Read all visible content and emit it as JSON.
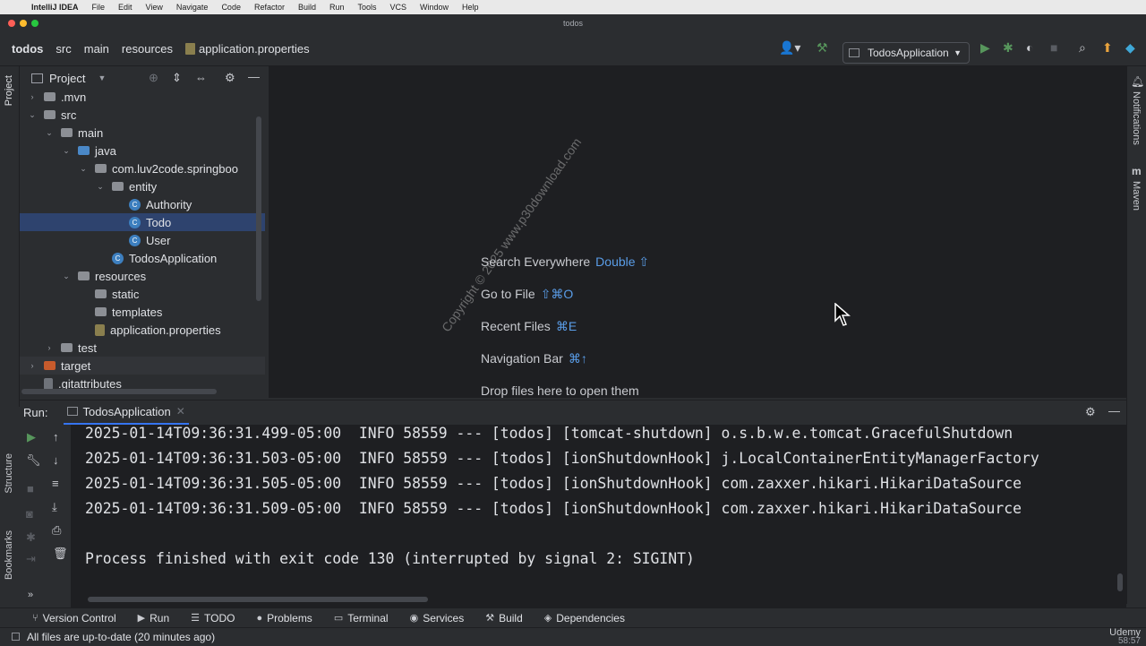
{
  "mac_menu": {
    "app": "IntelliJ IDEA",
    "items": [
      "File",
      "Edit",
      "View",
      "Navigate",
      "Code",
      "Refactor",
      "Build",
      "Run",
      "Tools",
      "VCS",
      "Window",
      "Help"
    ]
  },
  "window": {
    "title": "todos"
  },
  "breadcrumb": [
    "todos",
    "src",
    "main",
    "resources",
    "application.properties"
  ],
  "run_config": {
    "label": "TodosApplication"
  },
  "project_panel": {
    "title": "Project"
  },
  "tree": [
    {
      "label": ".mvn",
      "depth": 1,
      "arrow": "▶",
      "kind": "folder"
    },
    {
      "label": "src",
      "depth": 1,
      "arrow": "▼",
      "kind": "folder"
    },
    {
      "label": "main",
      "depth": 2,
      "arrow": "▼",
      "kind": "folder"
    },
    {
      "label": "java",
      "depth": 3,
      "arrow": "▼",
      "kind": "folder-blue"
    },
    {
      "label": "com.luv2code.springboo",
      "depth": 4,
      "arrow": "▼",
      "kind": "package"
    },
    {
      "label": "entity",
      "depth": 5,
      "arrow": "▼",
      "kind": "package"
    },
    {
      "label": "Authority",
      "depth": 6,
      "arrow": "",
      "kind": "class"
    },
    {
      "label": "Todo",
      "depth": 6,
      "arrow": "",
      "kind": "class",
      "selected": true
    },
    {
      "label": "User",
      "depth": 6,
      "arrow": "",
      "kind": "class"
    },
    {
      "label": "TodosApplication",
      "depth": 5,
      "arrow": "",
      "kind": "class-spring"
    },
    {
      "label": "resources",
      "depth": 3,
      "arrow": "▼",
      "kind": "folder-res"
    },
    {
      "label": "static",
      "depth": 4,
      "arrow": "",
      "kind": "folder"
    },
    {
      "label": "templates",
      "depth": 4,
      "arrow": "",
      "kind": "folder"
    },
    {
      "label": "application.properties",
      "depth": 4,
      "arrow": "",
      "kind": "props"
    },
    {
      "label": "test",
      "depth": 2,
      "arrow": "▶",
      "kind": "folder"
    },
    {
      "label": "target",
      "depth": 1,
      "arrow": "▶",
      "kind": "folder-orange",
      "highlight": true
    },
    {
      "label": ".gitattributes",
      "depth": 1,
      "arrow": "",
      "kind": "file"
    }
  ],
  "editor_hints": [
    {
      "label": "Search Everywhere",
      "keys": "Double ⇧"
    },
    {
      "label": "Go to File",
      "keys": "⇧⌘O"
    },
    {
      "label": "Recent Files",
      "keys": "⌘E"
    },
    {
      "label": "Navigation Bar",
      "keys": "⌘↑"
    },
    {
      "label": "Drop files here to open them",
      "keys": ""
    }
  ],
  "watermark": "Copyright © 2025 www.p30download.com",
  "run_panel": {
    "label": "Run:",
    "tab": "TodosApplication"
  },
  "console_lines": [
    "2025-01-14T09:36:31.499-05:00  INFO 58559 --- [todos] [tomcat-shutdown] o.s.b.w.e.tomcat.GracefulShutdown",
    "2025-01-14T09:36:31.503-05:00  INFO 58559 --- [todos] [ionShutdownHook] j.LocalContainerEntityManagerFactory",
    "2025-01-14T09:36:31.505-05:00  INFO 58559 --- [todos] [ionShutdownHook] com.zaxxer.hikari.HikariDataSource",
    "2025-01-14T09:36:31.509-05:00  INFO 58559 --- [todos] [ionShutdownHook] com.zaxxer.hikari.HikariDataSource",
    "",
    "Process finished with exit code 130 (interrupted by signal 2: SIGINT)"
  ],
  "bottom_tabs": [
    {
      "label": "Version Control",
      "icon": "⑂"
    },
    {
      "label": "Run",
      "icon": "▶",
      "active": true
    },
    {
      "label": "TODO",
      "icon": "☰"
    },
    {
      "label": "Problems",
      "icon": "●"
    },
    {
      "label": "Terminal",
      "icon": "▭"
    },
    {
      "label": "Services",
      "icon": "◉"
    },
    {
      "label": "Build",
      "icon": "⚒"
    },
    {
      "label": "Dependencies",
      "icon": "◈"
    }
  ],
  "status": {
    "text": "All files are up-to-date (20 minutes ago)",
    "udemy": "Udemy",
    "time": "58:57"
  },
  "side_labels": {
    "left_top": "Project",
    "left_structure": "Structure",
    "left_bookmarks": "Bookmarks",
    "right_notifications": "Notifications",
    "right_maven": "Maven"
  }
}
